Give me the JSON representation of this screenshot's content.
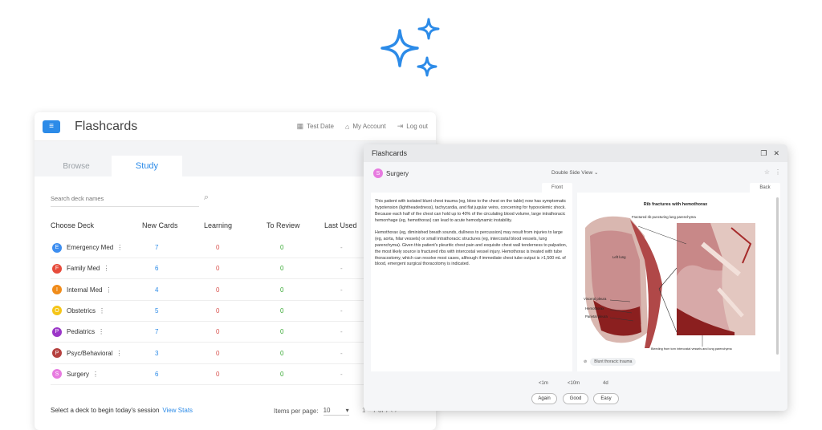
{
  "main": {
    "title": "Flashcards",
    "links": [
      {
        "label": "Test Date",
        "icon": "calendar-icon"
      },
      {
        "label": "My Account",
        "icon": "home-icon"
      },
      {
        "label": "Log out",
        "icon": "logout-icon"
      }
    ],
    "tabs": {
      "browse": "Browse",
      "study": "Study"
    },
    "search_placeholder": "Search deck names",
    "columns": [
      "Choose Deck",
      "New Cards",
      "Learning",
      "To Review",
      "Last Used"
    ],
    "decks": [
      {
        "letter": "E",
        "name": "Emergency Med",
        "color": "#3d8ef0",
        "new": "7",
        "learning": "0",
        "review": "0",
        "last": "-"
      },
      {
        "letter": "F",
        "name": "Family Med",
        "color": "#e74c3c",
        "new": "6",
        "learning": "0",
        "review": "0",
        "last": "-"
      },
      {
        "letter": "I",
        "name": "Internal Med",
        "color": "#f08c1a",
        "new": "4",
        "learning": "0",
        "review": "0",
        "last": "-"
      },
      {
        "letter": "O",
        "name": "Obstetrics",
        "color": "#f5c518",
        "new": "5",
        "learning": "0",
        "review": "0",
        "last": "-"
      },
      {
        "letter": "P",
        "name": "Pediatrics",
        "color": "#9b37c8",
        "new": "7",
        "learning": "0",
        "review": "0",
        "last": "-"
      },
      {
        "letter": "P",
        "name": "Psyc/Behavioral",
        "color": "#b5413f",
        "new": "3",
        "learning": "0",
        "review": "0",
        "last": "-"
      },
      {
        "letter": "S",
        "name": "Surgery",
        "color": "#e77be0",
        "new": "6",
        "learning": "0",
        "review": "0",
        "last": "-"
      }
    ],
    "footer_text": "Select a deck to begin today's session",
    "view_stats": "View Stats",
    "items_per_page_label": "Items per page:",
    "items_per_page_value": "10",
    "pager": "1 – 7 of 7"
  },
  "card": {
    "window_title": "Flashcards",
    "deck_letter": "S",
    "deck_name": "Surgery",
    "deck_color": "#e77be0",
    "view_mode": "Double Side View",
    "front_label": "Front",
    "back_label": "Back",
    "front_p1": "This patient with isolated blunt chest trauma (eg, blow to the chest on the table) now has symptomatic hypotension (lightheadedness), tachycardia, and flat jugular veins, concerning for hypovolemic shock. Because each half of the chest can hold up to 40% of the circulating blood volume, large intrathoracic hemorrhage (eg, hemothorax) can lead to acute hemodynamic instability.",
    "front_p2": "Hemothorax (eg, diminished breath sounds, dullness to percussion) may result from injuries to large (eg, aorta, hilar vessels) or small intrathoracic structures (eg, intercostal blood vessels, lung parenchyma). Given this patient's pleuritic chest pain and exquisite chest wall tenderness to palpation, the most likely source is fractured ribs with intercostal vessel injury. Hemothorax is treated with tube thoracostomy, which can resolve most cases, although if immediate chest tube output is >1,500 mL of blood, emergent surgical thoracotomy is indicated.",
    "image_title": "Rib fractures with hemothorax",
    "image_labels": {
      "fractured": "Fractured rib puncturing lung parenchyma",
      "left_lung": "Left lung",
      "visceral": "Visceral pleura",
      "hemothorax": "Hemothorax",
      "parietal": "Parietal pleura",
      "bleeding": "Bleeding from torn intercostal vessels and lung parenchyma"
    },
    "tag": "Blunt thoracic trauma",
    "intervals": [
      "<1m",
      "<10m",
      "4d"
    ],
    "answers": [
      "Again",
      "Good",
      "Easy"
    ]
  }
}
